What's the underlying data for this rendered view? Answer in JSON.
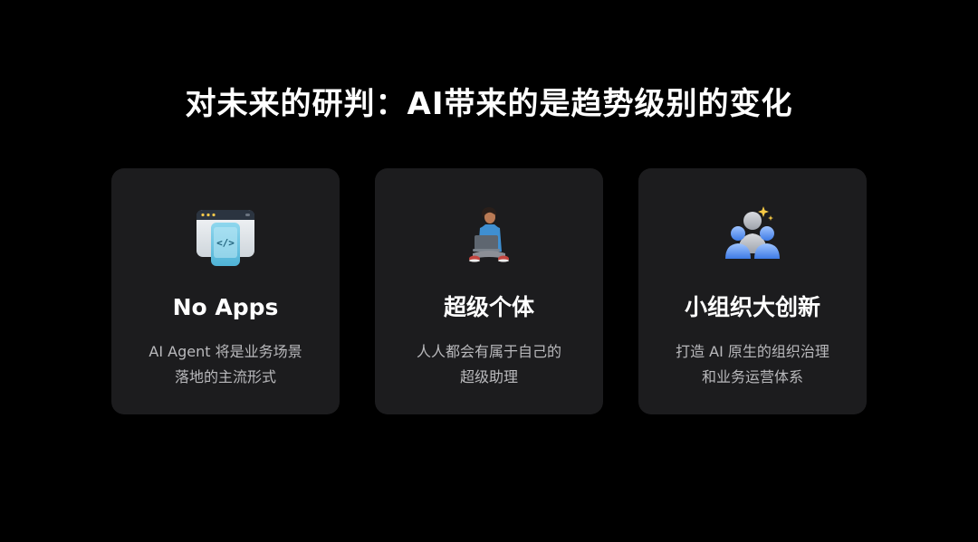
{
  "title": "对未来的研判：AI带来的是趋势级别的变化",
  "cards": [
    {
      "icon": "browser-code-icon",
      "title": "No Apps",
      "desc_lines": [
        "AI Agent 将是业务场景",
        "落地的主流形式"
      ]
    },
    {
      "icon": "person-laptop-icon",
      "title": "超级个体",
      "desc_lines": [
        "人人都会有属于自己的",
        "超级助理"
      ]
    },
    {
      "icon": "team-sparkle-icon",
      "title": "小组织大创新",
      "desc_lines": [
        "打造 AI 原生的组织治理",
        "和业务运营体系"
      ]
    }
  ],
  "colors": {
    "background": "#000000",
    "card": "#1c1c1e",
    "title": "#ffffff",
    "desc": "#b9b9bc",
    "accent_blue": "#5b9cf5"
  }
}
